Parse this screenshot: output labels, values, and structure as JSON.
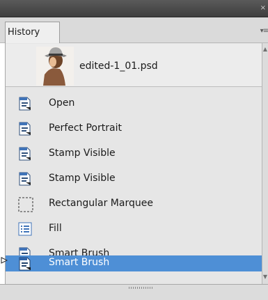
{
  "panel": {
    "tab_label": "History",
    "close_glyph": "×",
    "menu_glyph": "▾≡"
  },
  "snapshot": {
    "name": "edited-1_01.psd",
    "icon": "photo-thumbnail"
  },
  "history_items": [
    {
      "label": "Open",
      "icon": "document-icon"
    },
    {
      "label": "Perfect Portrait",
      "icon": "document-icon"
    },
    {
      "label": "Stamp Visible",
      "icon": "document-icon"
    },
    {
      "label": "Stamp Visible",
      "icon": "document-icon"
    },
    {
      "label": "Rectangular Marquee",
      "icon": "marquee-icon"
    },
    {
      "label": "Fill",
      "icon": "list-icon"
    },
    {
      "label": "Smart Brush",
      "icon": "document-icon"
    },
    {
      "label": "Smart Brush",
      "icon": "document-icon",
      "selected": true
    }
  ],
  "colors": {
    "selection": "#4e8fd6",
    "panel_bg": "#e6e6e6",
    "titlebar": "#4a4a4a"
  }
}
